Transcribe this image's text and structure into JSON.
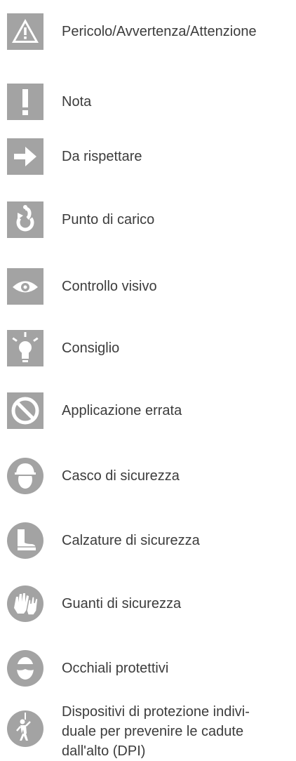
{
  "legend": {
    "items": [
      {
        "icon": "warning-triangle-icon",
        "label": "Pericolo/Avvertenza/Attenzione"
      },
      {
        "icon": "exclamation-icon",
        "label": "Nota"
      },
      {
        "icon": "arrow-right-icon",
        "label": "Da rispettare"
      },
      {
        "icon": "lifting-hook-icon",
        "label": "Punto di carico"
      },
      {
        "icon": "eye-icon",
        "label": "Controllo visivo"
      },
      {
        "icon": "lightbulb-icon",
        "label": "Consiglio"
      },
      {
        "icon": "prohibited-icon",
        "label": "Applicazione errata"
      },
      {
        "icon": "hard-hat-icon",
        "label": "Casco di sicurezza"
      },
      {
        "icon": "safety-boot-icon",
        "label": "Calzature di sicurezza"
      },
      {
        "icon": "gloves-icon",
        "label": "Guanti di sicurezza"
      },
      {
        "icon": "goggles-icon",
        "label": "Occhiali protettivi"
      },
      {
        "icon": "fall-protection-harness-icon",
        "label": "Dispositivi di protezione indivi-\nduale per prevenire le cadute\ndall'alto (DPI)"
      }
    ],
    "icon_color": "#a3a3a3",
    "symbol_color": "#ffffff",
    "text_color": "#3c3c3c"
  }
}
